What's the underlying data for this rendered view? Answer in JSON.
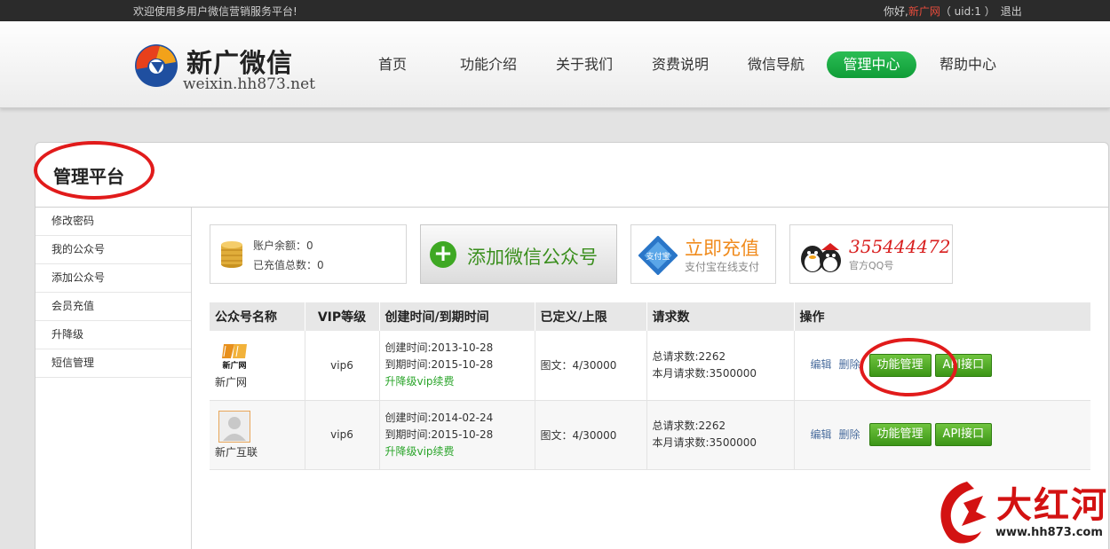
{
  "topbar": {
    "welcome": "欢迎使用多用户微信营销服务平台!",
    "greeting": "你好,",
    "username": "新广网",
    "uid": "（ uid:1 ）",
    "logout": "退出"
  },
  "brand": {
    "title": "新广微信",
    "url": "weixin.hh873.net"
  },
  "nav": [
    {
      "label": "首页"
    },
    {
      "label": "功能介绍"
    },
    {
      "label": "关于我们"
    },
    {
      "label": "资费说明"
    },
    {
      "label": "微信导航"
    },
    {
      "label": "管理中心",
      "active": true
    },
    {
      "label": "帮助中心"
    }
  ],
  "panel": {
    "title": "管理平台"
  },
  "sidebar": [
    {
      "label": "修改密码"
    },
    {
      "label": "我的公众号"
    },
    {
      "label": "添加公众号"
    },
    {
      "label": "会员充值"
    },
    {
      "label": "升降级"
    },
    {
      "label": "短信管理"
    }
  ],
  "balance": {
    "line1": "账户余额：0",
    "line2": "已充值总数：0"
  },
  "add_account": {
    "label": "添加微信公众号"
  },
  "recharge": {
    "icon_text": "支付宝",
    "title": "立即充值",
    "subtitle": "支付宝在线支付"
  },
  "qq": {
    "number": "355444472",
    "subtitle": "官方QQ号"
  },
  "table": {
    "headers": [
      "公众号名称",
      "VIP等级",
      "创建时间/到期时间",
      "已定义/上限",
      "请求数",
      "操作"
    ],
    "rows": [
      {
        "name": "新广网",
        "logo_text": "新广网",
        "vip": "vip6",
        "created": "创建时间:2013-10-28",
        "expires": "到期时间:2015-10-28",
        "renew": "升降级vip续费",
        "quota": "图文：4/30000",
        "total_req": "总请求数:2262",
        "month_req": "本月请求数:3500000",
        "edit": "编辑",
        "delete": "删除",
        "func_btn": "功能管理",
        "api_btn": "API接口"
      },
      {
        "name": "新广互联",
        "vip": "vip6",
        "created": "创建时间:2014-02-24",
        "expires": "到期时间:2015-10-28",
        "renew": "升降级vip续费",
        "quota": "图文：4/30000",
        "total_req": "总请求数:2262",
        "month_req": "本月请求数:3500000",
        "edit": "编辑",
        "delete": "删除",
        "func_btn": "功能管理",
        "api_btn": "API接口"
      }
    ]
  },
  "watermark": {
    "text": "大红河",
    "url": "www.hh873.com"
  },
  "colors": {
    "nav_active": "#12a53e",
    "button_green": "#4aa51f",
    "annotation_red": "#e11b1b"
  }
}
